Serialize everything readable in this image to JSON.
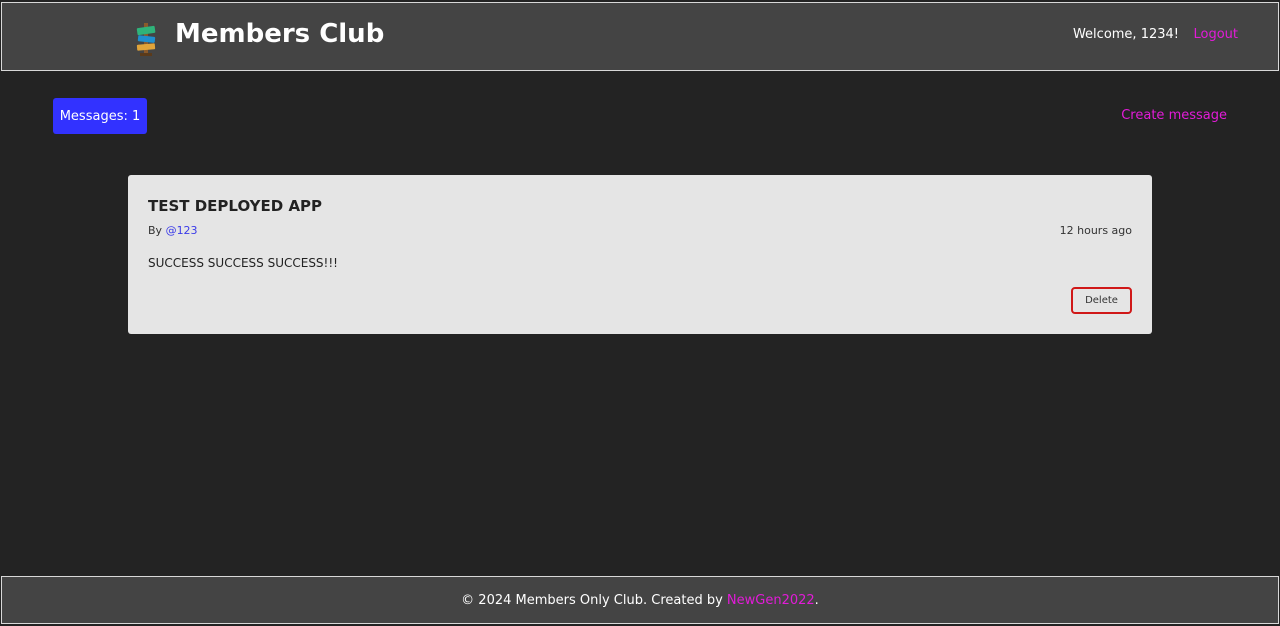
{
  "header": {
    "title": "Members Club",
    "welcome": "Welcome, 1234!",
    "logout": "Logout"
  },
  "toolbar": {
    "messages_count": "Messages: 1",
    "create_message": "Create message"
  },
  "messages": [
    {
      "title": "TEST DEPLOYED APP",
      "by_prefix": "By",
      "author": "@123",
      "time": "12 hours ago",
      "body": "SUCCESS SUCCESS SUCCESS!!!",
      "delete_label": "Delete"
    }
  ],
  "footer": {
    "text_prefix": "© 2024 Members Only Club. Created by",
    "author_link": "NewGen2022",
    "text_suffix": "."
  },
  "colors": {
    "accent_link": "#e21bd8",
    "badge": "#3232ff",
    "delete_border": "#d01818",
    "author_link": "#3b3be8"
  },
  "icons": {
    "logo": "signpost-logo-icon"
  }
}
